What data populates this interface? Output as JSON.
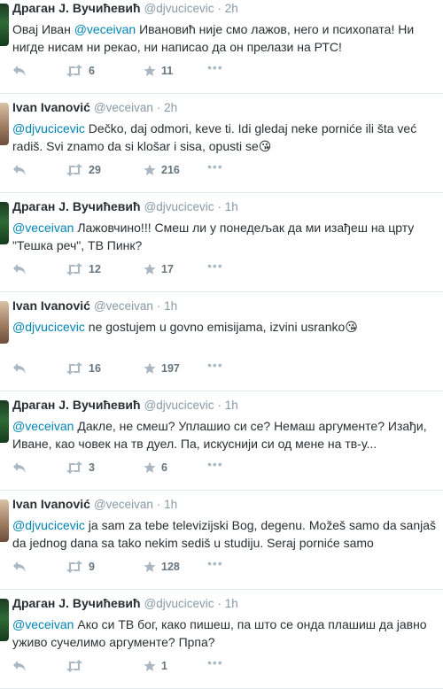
{
  "tweets": [
    {
      "author": "Драган Ј. Вучићевић",
      "handle": "@djvucicevic",
      "time": "2h",
      "avatar": "drag",
      "lines": [
        [
          {
            "t": "Овај Иван "
          },
          {
            "t": "@veceivan",
            "m": true
          },
          {
            "t": " Ивановић није смо лажов, него и психопата! Ни"
          }
        ],
        [
          {
            "t": "нигде нисам ни рекао, ни написао да он прелази на РТС!"
          }
        ]
      ],
      "retweets": "6",
      "favorites": "11"
    },
    {
      "author": "Ivan Ivanović",
      "handle": "@veceivan",
      "time": "2h",
      "avatar": "ivan",
      "lines": [
        [
          {
            "t": "@djvucicevic",
            "m": true
          },
          {
            "t": " Dečko, daj odmori, keve ti. Idi gledaj neke porniće ili šta već"
          }
        ],
        [
          {
            "t": "radiš. Svi znamo da si klošar i sisa, opusti se😘"
          }
        ]
      ],
      "retweets": "29",
      "favorites": "216"
    },
    {
      "author": "Драган Ј. Вучићевић",
      "handle": "@djvucicevic",
      "time": "1h",
      "avatar": "drag",
      "lines": [
        [
          {
            "t": "@veceivan",
            "m": true
          },
          {
            "t": " Лажовчино!!! Смеш ли у понедељак да ми изађеш на црту"
          }
        ],
        [
          {
            "t": "\"Тешка реч\", ТВ Пинк?"
          }
        ]
      ],
      "retweets": "12",
      "favorites": "17"
    },
    {
      "author": "Ivan Ivanović",
      "handle": "@veceivan",
      "time": "1h",
      "avatar": "ivan",
      "lines": [
        [
          {
            "t": "@djvucicevic",
            "m": true
          },
          {
            "t": " ne gostujem u govno emisijama, izvini usranko😘"
          }
        ]
      ],
      "retweets": "16",
      "favorites": "197"
    },
    {
      "author": "Драган Ј. Вучићевић",
      "handle": "@djvucicevic",
      "time": "1h",
      "avatar": "drag",
      "lines": [
        [
          {
            "t": "@veceivan",
            "m": true
          },
          {
            "t": " Дакле, не смеш? Уплашио си се? Немаш аргументе? Изађи,"
          }
        ],
        [
          {
            "t": "Иване, као човек на тв дуел. Па, искуснији си од мене на тв-у..."
          }
        ]
      ],
      "retweets": "3",
      "favorites": "6"
    },
    {
      "author": "Ivan Ivanović",
      "handle": "@veceivan",
      "time": "1h",
      "avatar": "ivan",
      "lines": [
        [
          {
            "t": "@djvucicevic",
            "m": true
          },
          {
            "t": " ja sam za tebe televizijski Bog, degenu. Možeš samo da sanjaš"
          }
        ],
        [
          {
            "t": "da jednog dana sa tako nekim sediš u studiju. Seraj porniće samo"
          }
        ]
      ],
      "retweets": "9",
      "favorites": "128"
    },
    {
      "author": "Драган Ј. Вучићевић",
      "handle": "@djvucicevic",
      "time": "1h",
      "avatar": "drag",
      "lines": [
        [
          {
            "t": "@veceivan",
            "m": true
          },
          {
            "t": " Ако си ТВ бог, како пишеш, па што се онда плашиш да јавно"
          }
        ],
        [
          {
            "t": "уживо сучелимо аргументе? Прпа?"
          }
        ]
      ],
      "retweets": "",
      "favorites": "1"
    }
  ],
  "separator": "·",
  "more_label": "•••"
}
